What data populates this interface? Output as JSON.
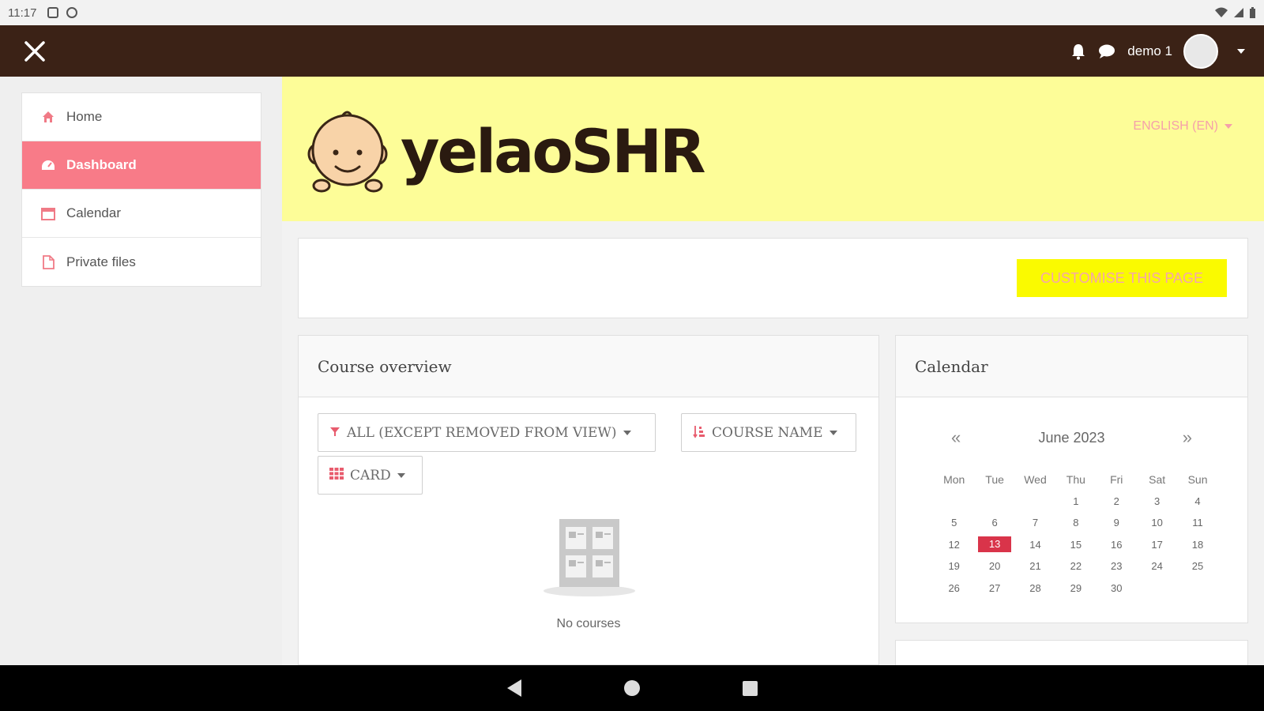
{
  "status_bar": {
    "time": "11:17"
  },
  "navbar": {
    "user_name": "demo 1"
  },
  "sidebar": {
    "items": [
      {
        "label": "Home",
        "icon": "home-icon",
        "active": false
      },
      {
        "label": "Dashboard",
        "icon": "dashboard-icon",
        "active": true
      },
      {
        "label": "Calendar",
        "icon": "calendar-icon",
        "active": false
      },
      {
        "label": "Private files",
        "icon": "file-icon",
        "active": false
      }
    ]
  },
  "banner": {
    "logo_text": "yelaoSHR",
    "language": "ENGLISH (EN)"
  },
  "header": {
    "customise_label": "CUSTOMISE THIS PAGE"
  },
  "course_overview": {
    "title": "Course overview",
    "filter_label": "ALL (EXCEPT REMOVED FROM VIEW)",
    "sort_label": "COURSE NAME",
    "view_label": "CARD",
    "empty_text": "No courses"
  },
  "calendar": {
    "title": "Calendar",
    "month": "June 2023",
    "prev": "«",
    "next": "»",
    "weekdays": [
      "Mon",
      "Tue",
      "Wed",
      "Thu",
      "Fri",
      "Sat",
      "Sun"
    ],
    "weeks": [
      [
        "",
        "",
        "",
        "1",
        "2",
        "3",
        "4"
      ],
      [
        "5",
        "6",
        "7",
        "8",
        "9",
        "10",
        "11"
      ],
      [
        "12",
        "13",
        "14",
        "15",
        "16",
        "17",
        "18"
      ],
      [
        "19",
        "20",
        "21",
        "22",
        "23",
        "24",
        "25"
      ],
      [
        "26",
        "27",
        "28",
        "29",
        "30",
        "",
        ""
      ]
    ],
    "today": "13"
  },
  "colors": {
    "navbar": "#3b2216",
    "accent": "#f87b88",
    "banner": "#fdfd98",
    "button": "#fafa00",
    "today": "#d9344a"
  }
}
